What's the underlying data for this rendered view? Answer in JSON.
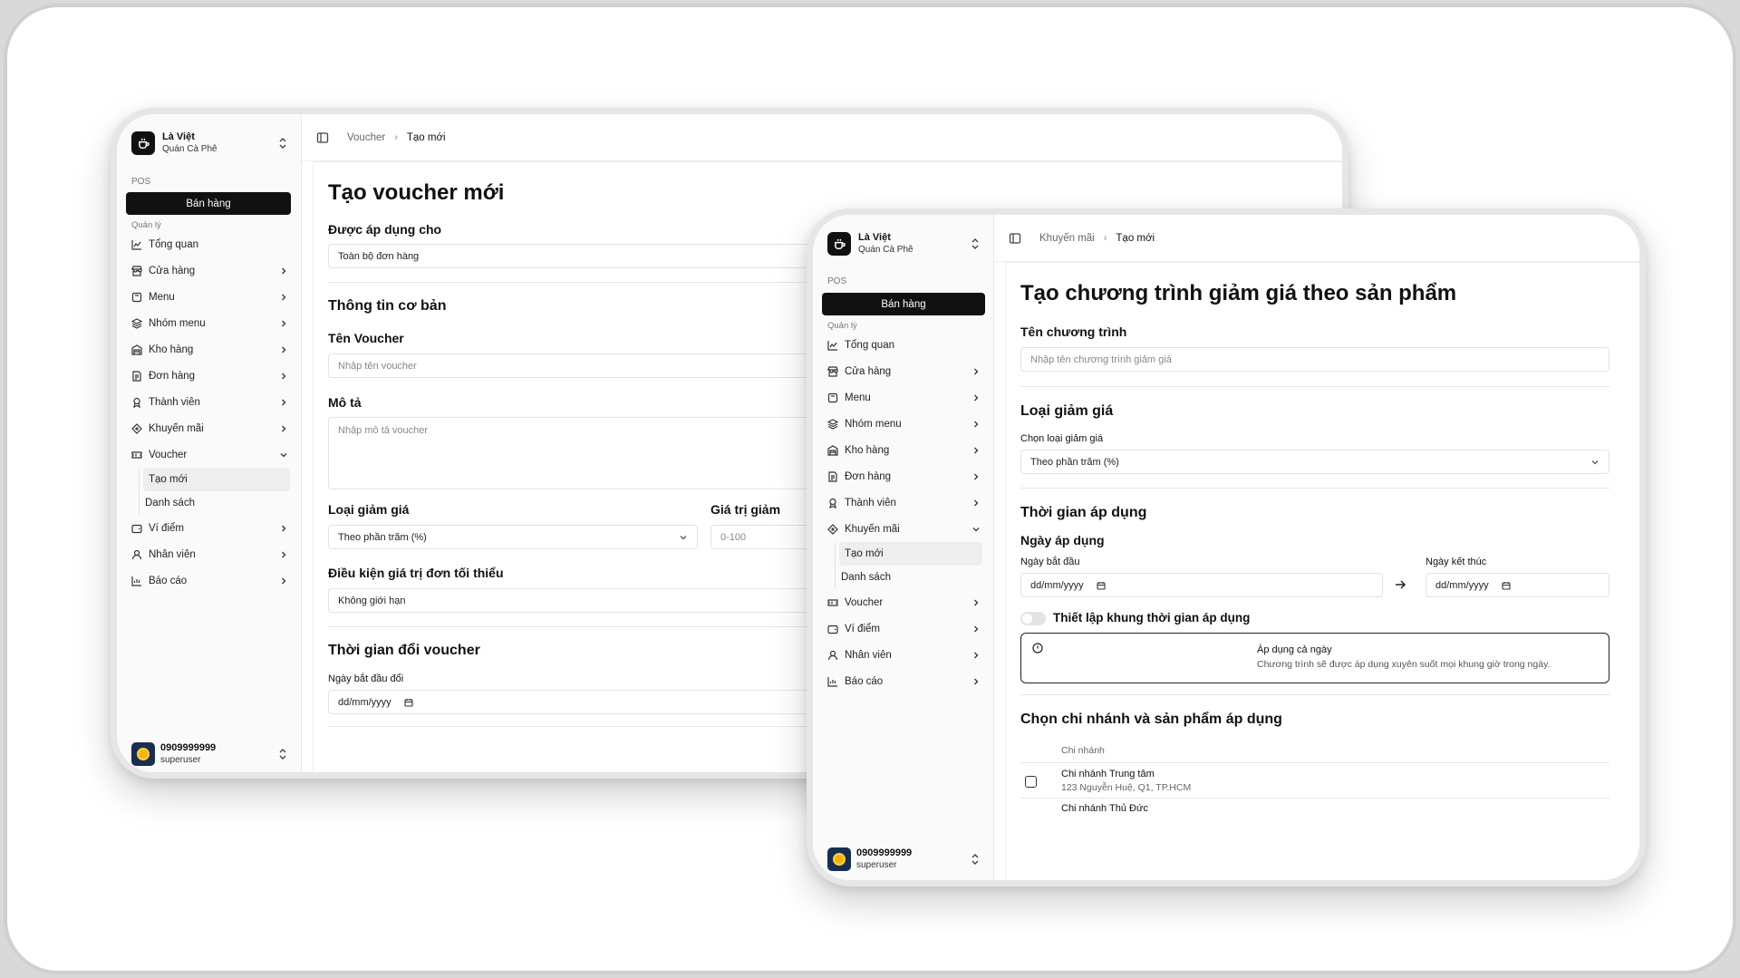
{
  "shared": {
    "brand_name": "Là Việt",
    "brand_sub": "Quán Cà Phê",
    "pos_label": "POS",
    "sales_button": "Bán hàng",
    "manage_label": "Quản lý",
    "user_phone": "0909999999",
    "user_role": "superuser"
  },
  "window1": {
    "breadcrumb": [
      "Voucher",
      "Tạo mới"
    ],
    "nav": [
      {
        "label": "Tổng quan",
        "icon": "chart-icon"
      },
      {
        "label": "Cửa hàng",
        "icon": "store-icon"
      },
      {
        "label": "Menu",
        "icon": "menu-icon"
      },
      {
        "label": "Nhóm menu",
        "icon": "layers-icon"
      },
      {
        "label": "Kho hàng",
        "icon": "warehouse-icon"
      },
      {
        "label": "Đơn hàng",
        "icon": "order-icon"
      },
      {
        "label": "Thành viên",
        "icon": "member-icon"
      },
      {
        "label": "Khuyến mãi",
        "icon": "promo-icon"
      },
      {
        "label": "Voucher",
        "icon": "voucher-icon"
      },
      {
        "label": "Ví điểm",
        "icon": "wallet-icon"
      },
      {
        "label": "Nhân viên",
        "icon": "user-icon"
      },
      {
        "label": "Báo cáo",
        "icon": "report-icon"
      }
    ],
    "sub_items": [
      "Tạo mới",
      "Danh sách"
    ],
    "title": "Tạo voucher mới",
    "applied_label": "Được áp dụng cho",
    "applied_value": "Toàn bộ đơn hàng",
    "basic_info": "Thông tin cơ bản",
    "voucher_name_label": "Tên Voucher",
    "voucher_name_placeholder": "Nhập tên voucher",
    "desc_label": "Mô tả",
    "desc_placeholder": "Nhập mô tả voucher",
    "discount_type_label": "Loại giảm giá",
    "discount_type_value": "Theo phần trăm (%)",
    "discount_value_label": "Giá trị giảm",
    "discount_value_placeholder": "0-100",
    "min_order_label": "Điều kiện giá trị đơn tối thiểu",
    "min_order_value": "Không giới hạn",
    "redeem_time": "Thời gian đổi voucher",
    "start_date_label": "Ngày bắt đầu đổi",
    "date_placeholder": "dd/mm/yyyy"
  },
  "window2": {
    "breadcrumb": [
      "Khuyến mãi",
      "Tạo mới"
    ],
    "nav": [
      {
        "label": "Tổng quan",
        "icon": "chart-icon"
      },
      {
        "label": "Cửa hàng",
        "icon": "store-icon"
      },
      {
        "label": "Menu",
        "icon": "menu-icon"
      },
      {
        "label": "Nhóm menu",
        "icon": "layers-icon"
      },
      {
        "label": "Kho hàng",
        "icon": "warehouse-icon"
      },
      {
        "label": "Đơn hàng",
        "icon": "order-icon"
      },
      {
        "label": "Thành viên",
        "icon": "member-icon"
      },
      {
        "label": "Khuyến mãi",
        "icon": "promo-icon"
      },
      {
        "label": "Voucher",
        "icon": "voucher-icon"
      },
      {
        "label": "Ví điểm",
        "icon": "wallet-icon"
      },
      {
        "label": "Nhân viên",
        "icon": "user-icon"
      },
      {
        "label": "Báo cáo",
        "icon": "report-icon"
      }
    ],
    "sub_items": [
      "Tạo mới",
      "Danh sách"
    ],
    "title": "Tạo chương trình giảm giá theo sản phẩm",
    "program_name_label": "Tên chương trình",
    "program_name_placeholder": "Nhập tên chương trình giảm giá",
    "discount_type_heading": "Loại giảm giá",
    "choose_type_label": "Chọn loại giảm giá",
    "choose_type_value": "Theo phần trăm (%)",
    "apply_time_heading": "Thời gian áp dụng",
    "apply_date_heading": "Ngày áp dụng",
    "start_label": "Ngày bắt đầu",
    "end_label": "Ngày kết thúc",
    "date_placeholder": "dd/mm/yyyy",
    "timeframe_toggle": "Thiết lập khung thời gian áp dụng",
    "all_day_title": "Áp dụng cả ngày",
    "all_day_desc": "Chương trình sẽ được áp dụng xuyên suốt mọi khung giờ trong ngày.",
    "branch_heading": "Chọn chi nhánh và sản phẩm áp dụng",
    "branch_col": "Chi nhánh",
    "branches": [
      {
        "name": "Chi nhánh Trung tâm",
        "address": "123 Nguyễn Huệ, Q1, TP.HCM"
      },
      {
        "name": "Chi nhánh Thủ Đức",
        "address": ""
      }
    ]
  }
}
